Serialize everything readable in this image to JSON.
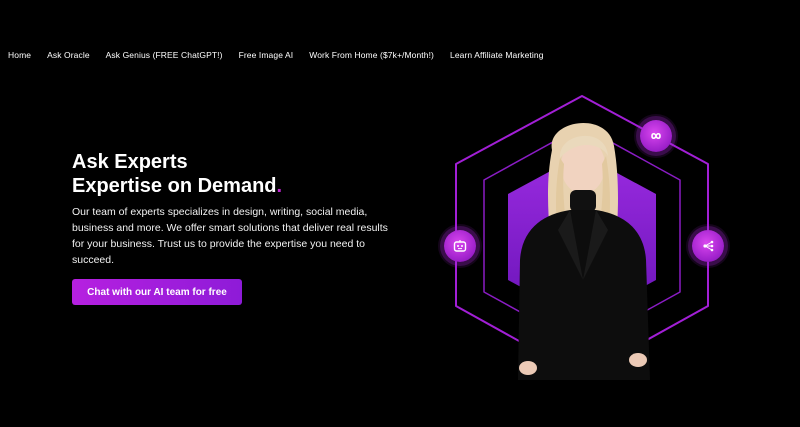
{
  "nav": {
    "items": [
      {
        "label": "Home"
      },
      {
        "label": "Ask Oracle"
      },
      {
        "label": "Ask Genius (FREE ChatGPT!)"
      },
      {
        "label": "Free Image AI"
      },
      {
        "label": "Work From Home ($7k+/Month!)"
      },
      {
        "label": "Learn Affiliate Marketing"
      }
    ]
  },
  "hero": {
    "title_line1": "Ask Experts",
    "title_line2": "Expertise on Demand",
    "title_dot": ".",
    "description": "Our team of experts specializes in design, writing, social media, business and more. We offer smart solutions that deliver real results for your business. Trust us to provide the expertise you need to succeed.",
    "cta_label": "Chat with our AI team for free"
  },
  "icons": {
    "top_right": "infinity-icon",
    "left": "robot-icon",
    "right": "network-hub-icon"
  },
  "colors": {
    "background": "#000000",
    "accent": "#b620e0",
    "accent_dark": "#8e1bd8",
    "hexagon_fill": "#7e1ed0",
    "ring_stroke": "#a21fd6"
  }
}
